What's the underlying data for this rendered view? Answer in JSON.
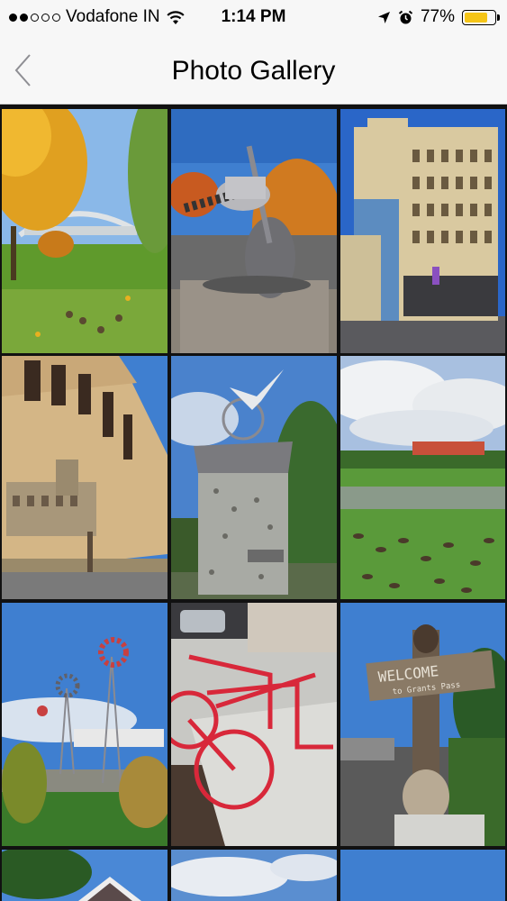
{
  "status_bar": {
    "carrier": "Vodafone IN",
    "time": "1:14 PM",
    "battery": "77%",
    "battery_level": 0.77,
    "signal_bars": 2,
    "icons": [
      "wifi-icon",
      "location-arrow-icon",
      "alarm-icon",
      "battery-icon"
    ]
  },
  "nav": {
    "title": "Photo Gallery",
    "back_icon": "chevron-left-icon"
  },
  "gallery": {
    "columns": 3,
    "photos": [
      {
        "subject": "autumn-park-bridge"
      },
      {
        "subject": "cello-sculpture"
      },
      {
        "subject": "historic-building"
      },
      {
        "subject": "mural-wall"
      },
      {
        "subject": "bird-sculpture"
      },
      {
        "subject": "geese-park"
      },
      {
        "subject": "windmills"
      },
      {
        "subject": "red-bike-rack"
      },
      {
        "subject": "bear-welcome-sign",
        "sign_lines": [
          "WELCOME",
          "to Grants Pass"
        ]
      },
      {
        "subject": "house-tree"
      },
      {
        "subject": "clouds"
      },
      {
        "subject": "blue-sky"
      }
    ]
  }
}
